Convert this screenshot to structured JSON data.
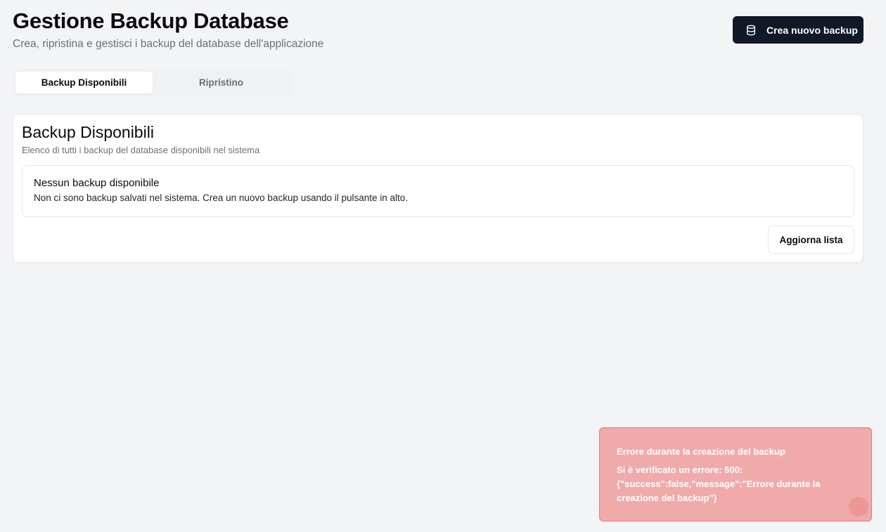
{
  "header": {
    "title": "Gestione Backup Database",
    "subtitle": "Crea, ripristina e gestisci i backup del database dell'applicazione",
    "create_button": {
      "label": "Crea nuovo backup",
      "icon": "database-icon"
    }
  },
  "tabs": [
    {
      "label": "Backup Disponibili",
      "active": true
    },
    {
      "label": "Ripristino",
      "active": false
    }
  ],
  "card": {
    "title": "Backup Disponibili",
    "description": "Elenco di tutti i backup del database disponibili nel sistema",
    "empty_state": {
      "title": "Nessun backup disponibile",
      "text": "Non ci sono backup salvati nel sistema. Crea un nuovo backup usando il pulsante in alto."
    },
    "refresh_button": "Aggiorna lista"
  },
  "toast": {
    "title": "Errore durante la creazione del backup",
    "message": "Si è verificato un errore: 500: {\"success\":false,\"message\":\"Errore durante la creazione del backup\"}"
  },
  "colors": {
    "primary_button": "#111827",
    "toast_background": "#f1aaaa",
    "toast_border": "#e67a7a",
    "page_background": "#f3f4f6"
  }
}
